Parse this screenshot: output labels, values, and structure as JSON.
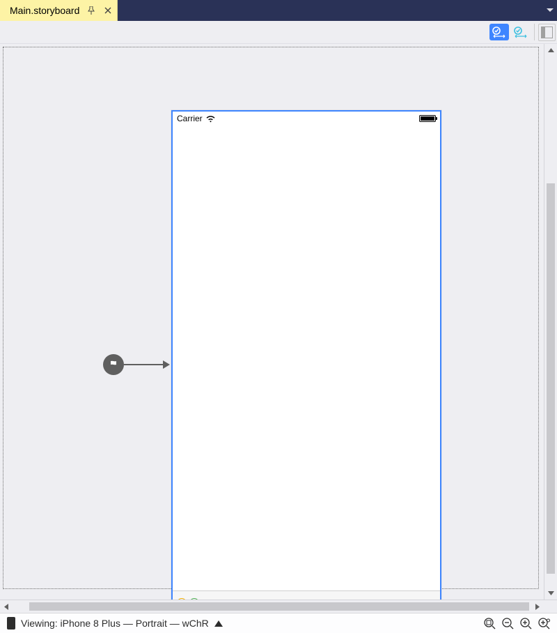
{
  "tab": {
    "title": "Main.storyboard"
  },
  "statusbar": {
    "carrier": "Carrier"
  },
  "bottom": {
    "viewing": "Viewing: iPhone 8 Plus — Portrait — wChR"
  }
}
